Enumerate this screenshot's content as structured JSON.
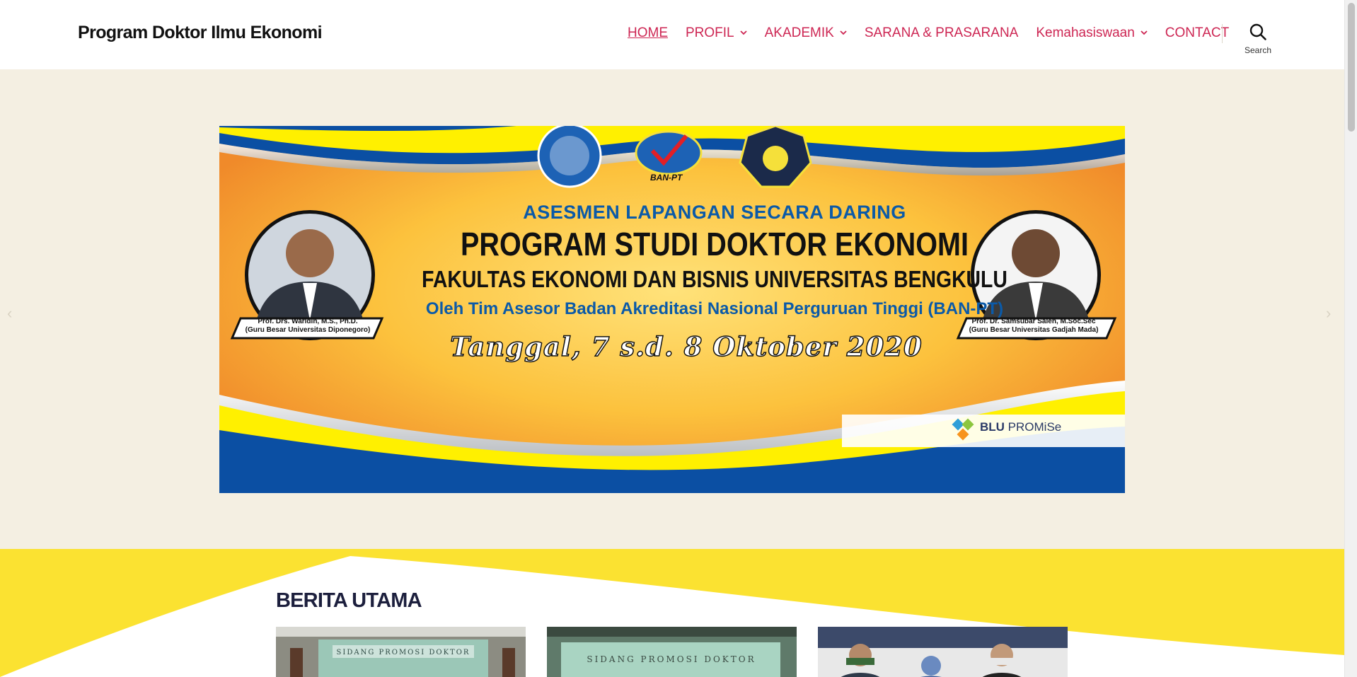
{
  "site": {
    "title": "Program Doktor Ilmu Ekonomi"
  },
  "nav": {
    "items": [
      {
        "label": "HOME",
        "active": true,
        "dropdown": false
      },
      {
        "label": "PROFIL",
        "active": false,
        "dropdown": true
      },
      {
        "label": "AKADEMIK",
        "active": false,
        "dropdown": true
      },
      {
        "label": "SARANA & PRASARANA",
        "active": false,
        "dropdown": false
      },
      {
        "label": "Kemahasiswaan",
        "active": false,
        "dropdown": true
      },
      {
        "label": "CONTACT",
        "active": false,
        "dropdown": false
      }
    ],
    "search_label": "Search",
    "accent_color": "#cd2653"
  },
  "banner": {
    "subtitle": "ASESMEN LAPANGAN SECARA DARING",
    "title": "PROGRAM STUDI DOKTOR EKONOMI",
    "faculty": "FAKULTAS EKONOMI DAN BISNIS UNIVERSITAS BENGKULU",
    "assessor": "Oleh Tim Asesor Badan Akreditasi Nasional Perguruan Tinggi (BAN-PT)",
    "date": "Tanggal, 7 s.d. 8 Oktober 2020",
    "logo_label": "BAN-PT",
    "person_left": {
      "name": "Prof. Drs. Waridin, M.S., Ph.D.",
      "affiliation": "(Guru Besar Universitas Diponegoro)"
    },
    "person_right": {
      "name": "Prof. Dr. Samsubar Saleh, M.Soc.Sec",
      "affiliation": "(Guru Besar Universitas Gadjah Mada)"
    },
    "partner": {
      "name_bold": "BLU",
      "name_rest": " PROMiSe"
    }
  },
  "news": {
    "heading": "BERITA UTAMA",
    "card_1_caption": "SIDANG PROMOSI DOKTOR",
    "card_2_caption": "SIDANG PROMOSI DOKTOR"
  }
}
